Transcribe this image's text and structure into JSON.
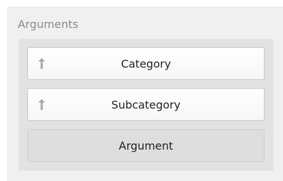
{
  "section": {
    "title": "Arguments"
  },
  "items": [
    {
      "label": "Category",
      "icon": "sort-ascending-arrow-icon"
    },
    {
      "label": "Subcategory",
      "icon": "sort-ascending-arrow-icon"
    },
    {
      "label": "Argument"
    }
  ],
  "colors": {
    "panel_bg": "#f0f0f0",
    "well_bg": "#e2e2e2",
    "item_bg": "#ffffff",
    "placeholder_bg": "#dedede",
    "title_text": "#8a8a8a",
    "item_text": "#1f1f1f",
    "icon_color": "#a7a7a7"
  }
}
